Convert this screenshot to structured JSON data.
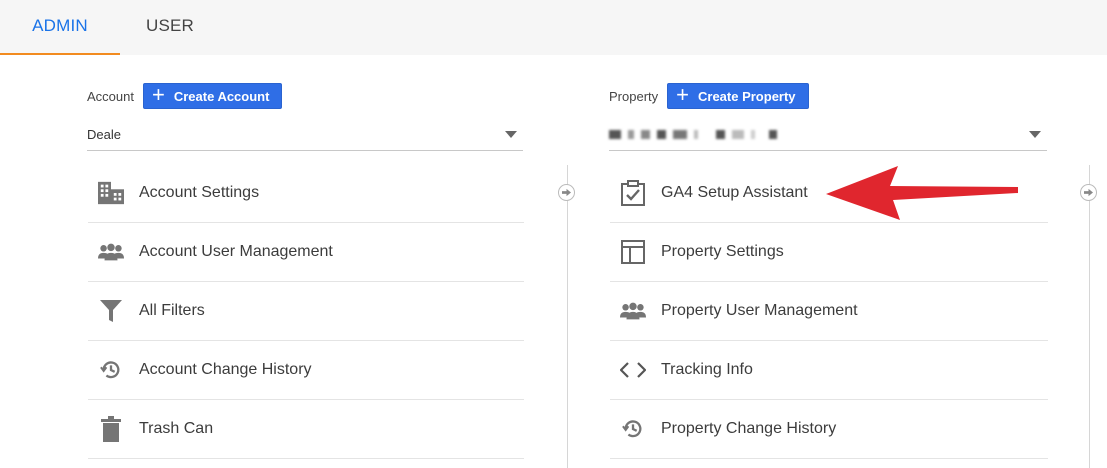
{
  "tabs": {
    "admin": "ADMIN",
    "user": "USER"
  },
  "account": {
    "label": "Account",
    "create_label": "Create Account",
    "selected": "Deale",
    "items": [
      {
        "label": "Account Settings",
        "icon": "building-icon"
      },
      {
        "label": "Account User Management",
        "icon": "people-icon"
      },
      {
        "label": "All Filters",
        "icon": "filter-icon"
      },
      {
        "label": "Account Change History",
        "icon": "history-icon"
      },
      {
        "label": "Trash Can",
        "icon": "trash-icon"
      }
    ]
  },
  "property": {
    "label": "Property",
    "create_label": "Create Property",
    "items": [
      {
        "label": "GA4 Setup Assistant",
        "icon": "checklist-icon"
      },
      {
        "label": "Property Settings",
        "icon": "layout-icon"
      },
      {
        "label": "Property User Management",
        "icon": "people-icon"
      },
      {
        "label": "Tracking Info",
        "icon": "code-icon"
      },
      {
        "label": "Property Change History",
        "icon": "history-icon"
      }
    ]
  },
  "colors": {
    "accent": "#1a73e8",
    "button": "#2f6ee6",
    "tab_underline": "#f28b20",
    "annotation_arrow": "#e0262e"
  }
}
